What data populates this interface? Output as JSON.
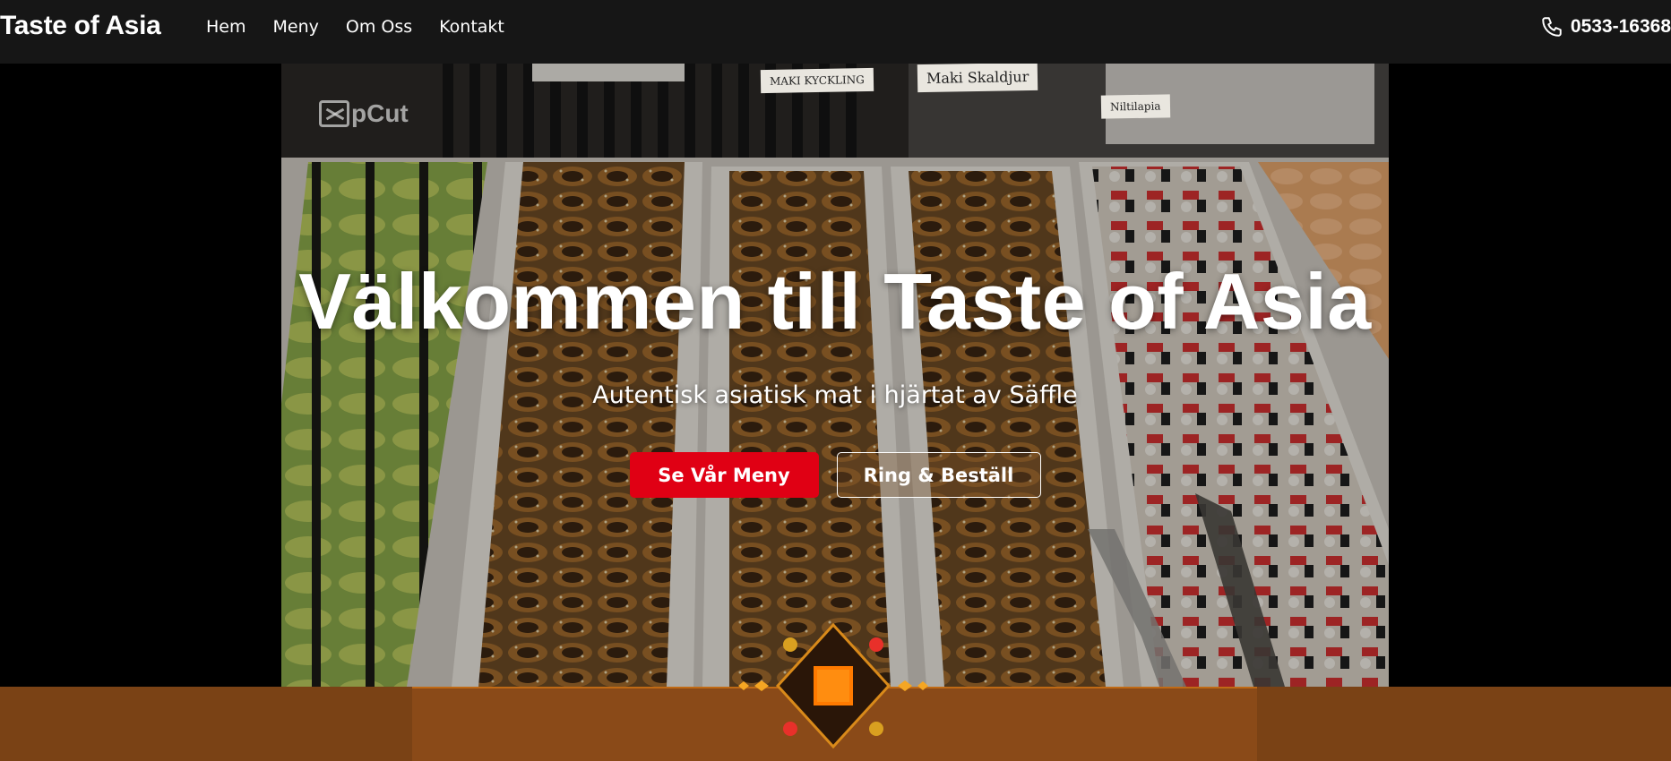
{
  "nav": {
    "brand": "Taste of Asia",
    "links": [
      "Hem",
      "Meny",
      "Om Oss",
      "Kontakt"
    ],
    "phone": "0533-16368"
  },
  "hero": {
    "watermark": "pCut",
    "labels": [
      "MAKI KYCKLING",
      "Maki Skaldjur",
      "Niltilapia"
    ],
    "title": "Välkommen till Taste of Asia",
    "subtitle": "Autentisk asiatisk mat i hjärtat av Säffle",
    "primary_button": "Se Vår Meny",
    "secondary_button": "Ring & Beställ"
  },
  "colors": {
    "nav_bg": "#161616",
    "primary": "#e00014",
    "band": "#7a4215",
    "ornament_orange": "#ff8a00"
  }
}
